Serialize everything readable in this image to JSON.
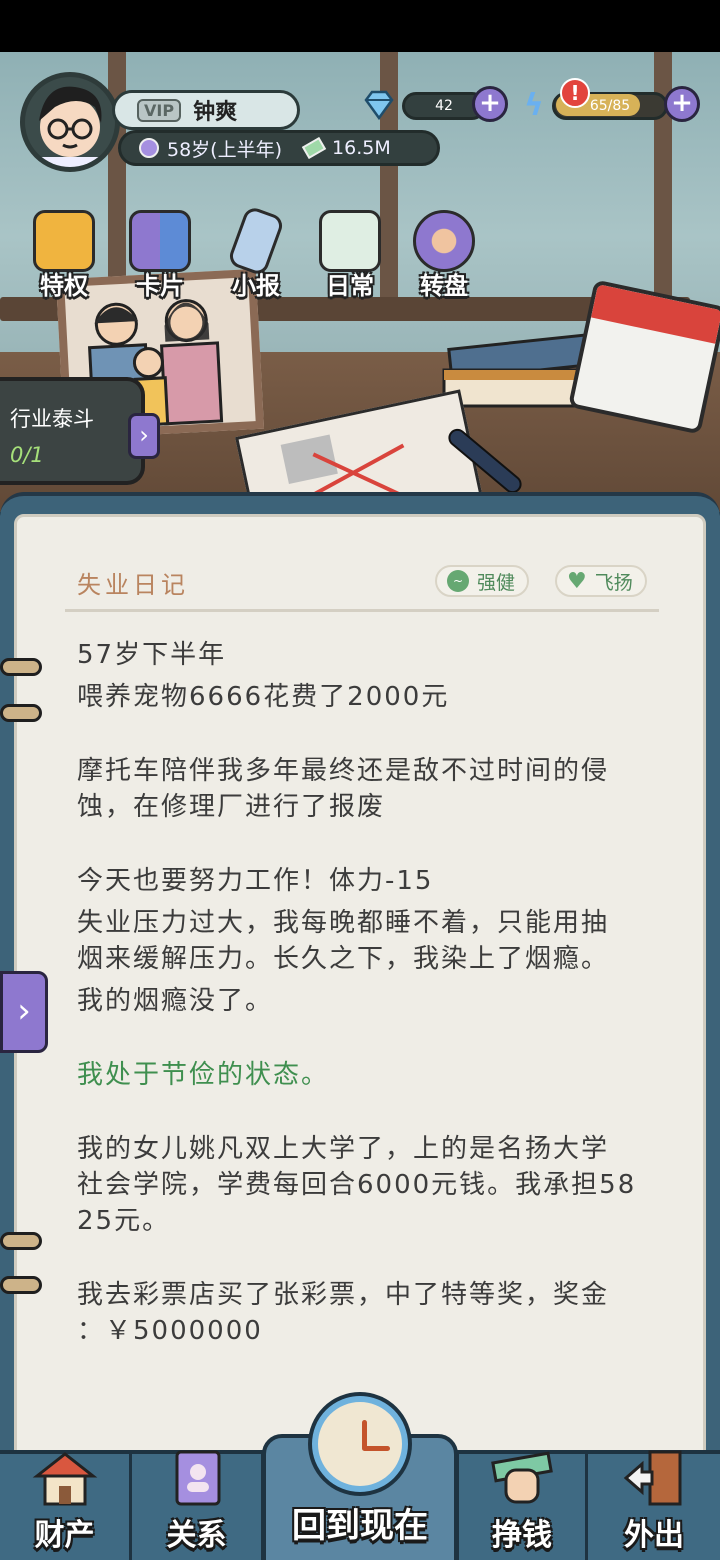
{
  "header": {
    "vip_label": "VIP",
    "player_name": "钟爽",
    "age": "58岁(上半年)",
    "money": "16.5M",
    "diamonds": "42",
    "energy": "65/85",
    "energy_fill": 0.76,
    "alert": "!"
  },
  "shortcuts": [
    {
      "label": "特权",
      "icon": "vip-icon"
    },
    {
      "label": "卡片",
      "icon": "cards-icon"
    },
    {
      "label": "小报",
      "icon": "newspaper-icon"
    },
    {
      "label": "日常",
      "icon": "checklist-icon"
    },
    {
      "label": "转盘",
      "icon": "wheel-icon"
    }
  ],
  "industry": {
    "title": "行业泰斗",
    "progress": "0/1"
  },
  "diary": {
    "title": "失业日记",
    "tags": [
      {
        "label": "强健",
        "icon": "pulse-icon"
      },
      {
        "label": "飞扬",
        "icon": "heart-icon"
      }
    ],
    "lines": {
      "l1": "57岁下半年",
      "l2": "喂养宠物6666花费了2000元",
      "l3": "摩托车陪伴我多年最终还是敌不过时间的侵",
      "l4": "蚀，在修理厂进行了报废",
      "l5": "今天也要努力工作！体力-15",
      "l6": "失业压力过大，我每晚都睡不着，只能用抽",
      "l7": "烟来缓解压力。长久之下，我染上了烟瘾。",
      "l8": "我的烟瘾没了。",
      "l9": "我处于节俭的状态。",
      "l10": "我的女儿姚凡双上大学了，上的是名扬大学",
      "l11": "社会学院，学费每回合6000元钱。我承担58",
      "l12": "25元。",
      "l13": "我去彩票店买了张彩票，中了特等奖，奖金",
      "l14": "：￥5000000"
    }
  },
  "nav": {
    "assets": "财产",
    "relations": "关系",
    "back_to_now": "回到现在",
    "earn": "挣钱",
    "go_out": "外出"
  },
  "colors": {
    "accent_purple": "#8e78cf",
    "diary_green": "#3f8f4f",
    "title_brown": "#b9845f"
  }
}
